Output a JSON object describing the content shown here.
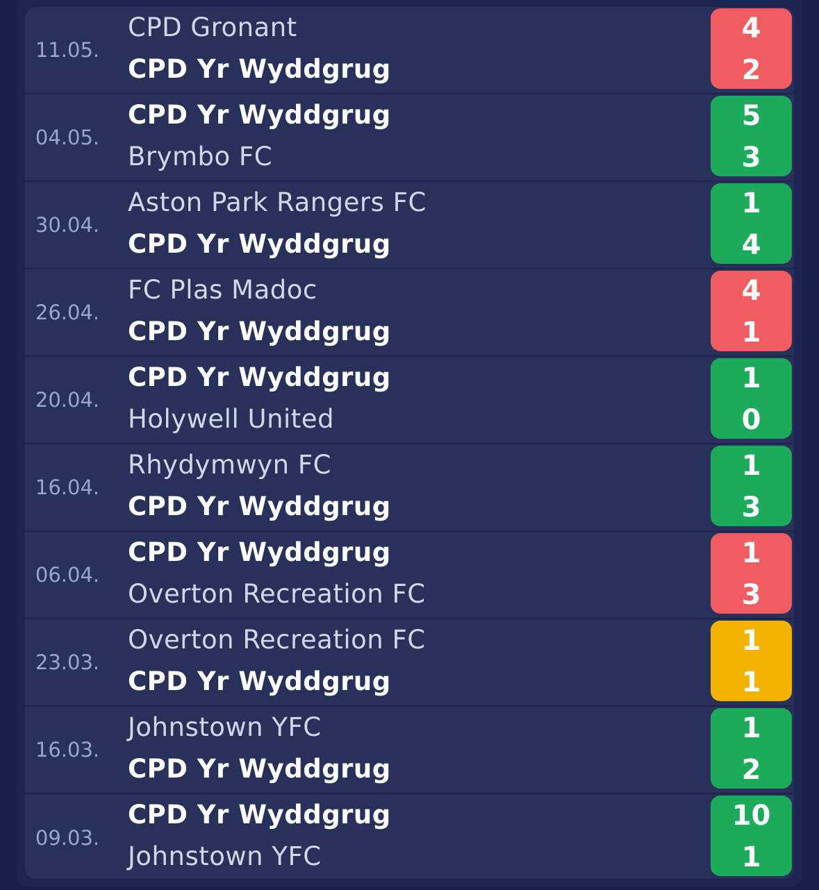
{
  "colors": {
    "loss": "#f05d61",
    "win": "#1bab5a",
    "draw": "#f2b200",
    "background": "#18204a",
    "row": "#283159",
    "date_text": "#97a4d6"
  },
  "matches": [
    {
      "date": "11.05.",
      "home": "CPD Gronant",
      "away": "CPD Yr Wyddgrug",
      "home_score": "4",
      "away_score": "2",
      "result": "loss",
      "highlight": "away"
    },
    {
      "date": "04.05.",
      "home": "CPD Yr Wyddgrug",
      "away": "Brymbo FC",
      "home_score": "5",
      "away_score": "3",
      "result": "win",
      "highlight": "home"
    },
    {
      "date": "30.04.",
      "home": "Aston Park Rangers FC",
      "away": "CPD Yr Wyddgrug",
      "home_score": "1",
      "away_score": "4",
      "result": "win",
      "highlight": "away"
    },
    {
      "date": "26.04.",
      "home": "FC Plas Madoc",
      "away": "CPD Yr Wyddgrug",
      "home_score": "4",
      "away_score": "1",
      "result": "loss",
      "highlight": "away"
    },
    {
      "date": "20.04.",
      "home": "CPD Yr Wyddgrug",
      "away": "Holywell United",
      "home_score": "1",
      "away_score": "0",
      "result": "win",
      "highlight": "home"
    },
    {
      "date": "16.04.",
      "home": "Rhydymwyn FC",
      "away": "CPD Yr Wyddgrug",
      "home_score": "1",
      "away_score": "3",
      "result": "win",
      "highlight": "away"
    },
    {
      "date": "06.04.",
      "home": "CPD Yr Wyddgrug",
      "away": "Overton Recreation FC",
      "home_score": "1",
      "away_score": "3",
      "result": "loss",
      "highlight": "home"
    },
    {
      "date": "23.03.",
      "home": "Overton Recreation FC",
      "away": "CPD Yr Wyddgrug",
      "home_score": "1",
      "away_score": "1",
      "result": "draw",
      "highlight": "away"
    },
    {
      "date": "16.03.",
      "home": "Johnstown YFC",
      "away": "CPD Yr Wyddgrug",
      "home_score": "1",
      "away_score": "2",
      "result": "win",
      "highlight": "away"
    },
    {
      "date": "09.03.",
      "home": "CPD Yr Wyddgrug",
      "away": "Johnstown YFC",
      "home_score": "10",
      "away_score": "1",
      "result": "win",
      "highlight": "home"
    }
  ]
}
